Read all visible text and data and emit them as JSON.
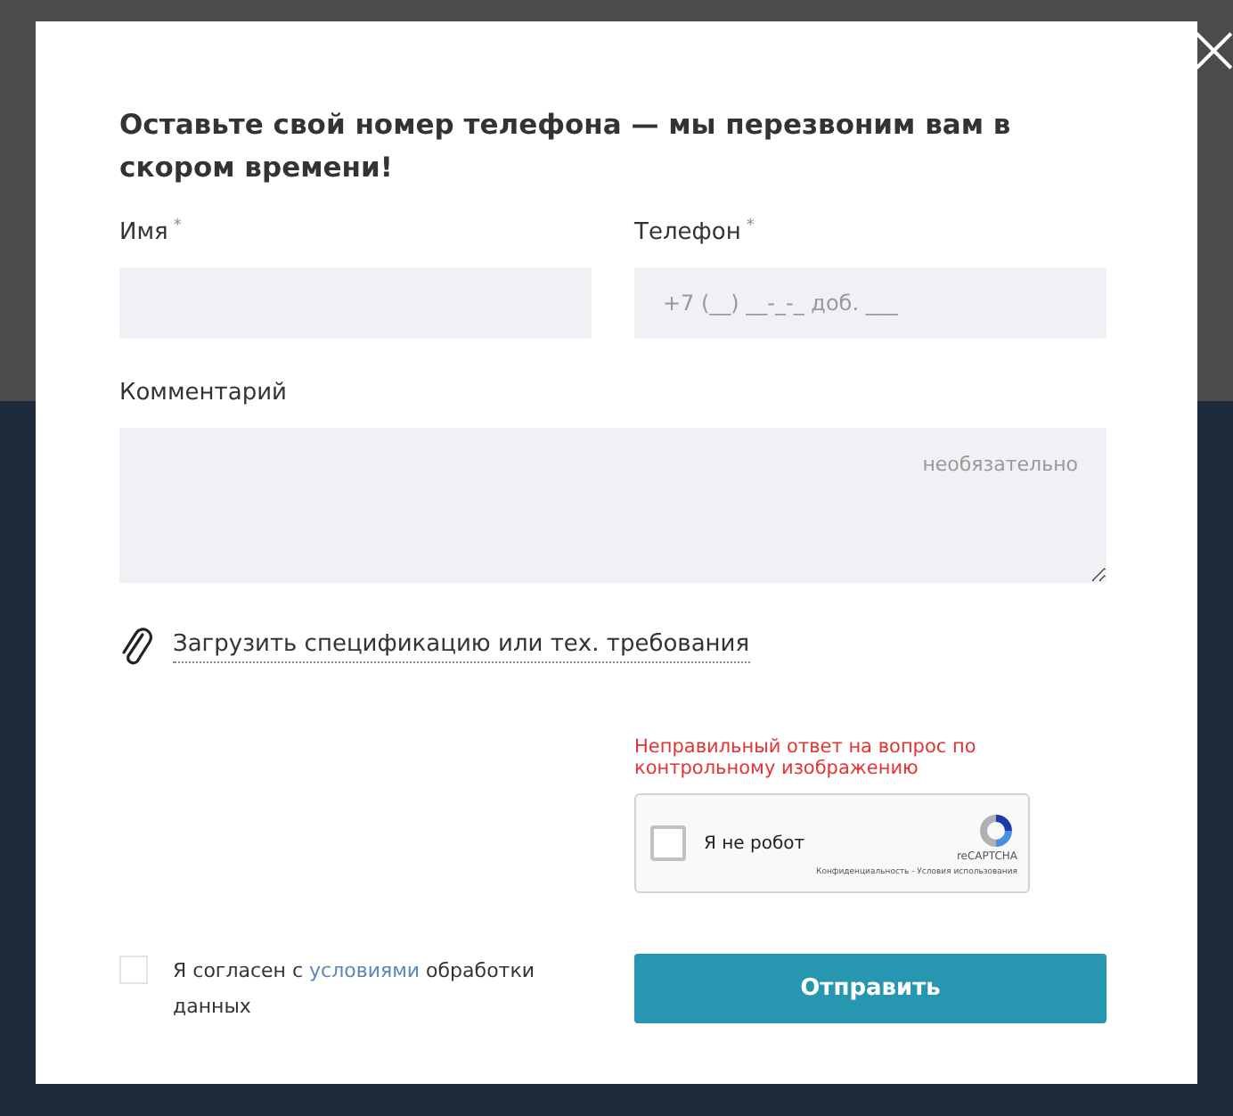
{
  "dialog": {
    "title": "Оставьте свой номер телефона — мы перезвоним вам в скором времени!",
    "close_icon": "×"
  },
  "fields": [
    {
      "kind": "input",
      "label": "Имя",
      "required_mark": "*"
    },
    {
      "kind": "input",
      "label": "Телефон",
      "required_mark": "*",
      "placeholder": "+7 (__) __-_-_ доб. ___"
    }
  ],
  "comment": {
    "label": "Комментарий",
    "placeholder": "необязательно"
  },
  "upload_link": "Загрузить спецификацию или тех. требования",
  "captcha": {
    "error": "Неправильный ответ на вопрос по контрольному изображению",
    "label": "Я не робот",
    "checked": false,
    "brand": "reCAPTCHA",
    "footer": "Конфиденциальность - Условия использования"
  },
  "agreement": {
    "checked": false,
    "text_before": "Я согласен с",
    "link": "условиями",
    "text_after": "обработки данных"
  },
  "submit_button": "Отправить"
}
